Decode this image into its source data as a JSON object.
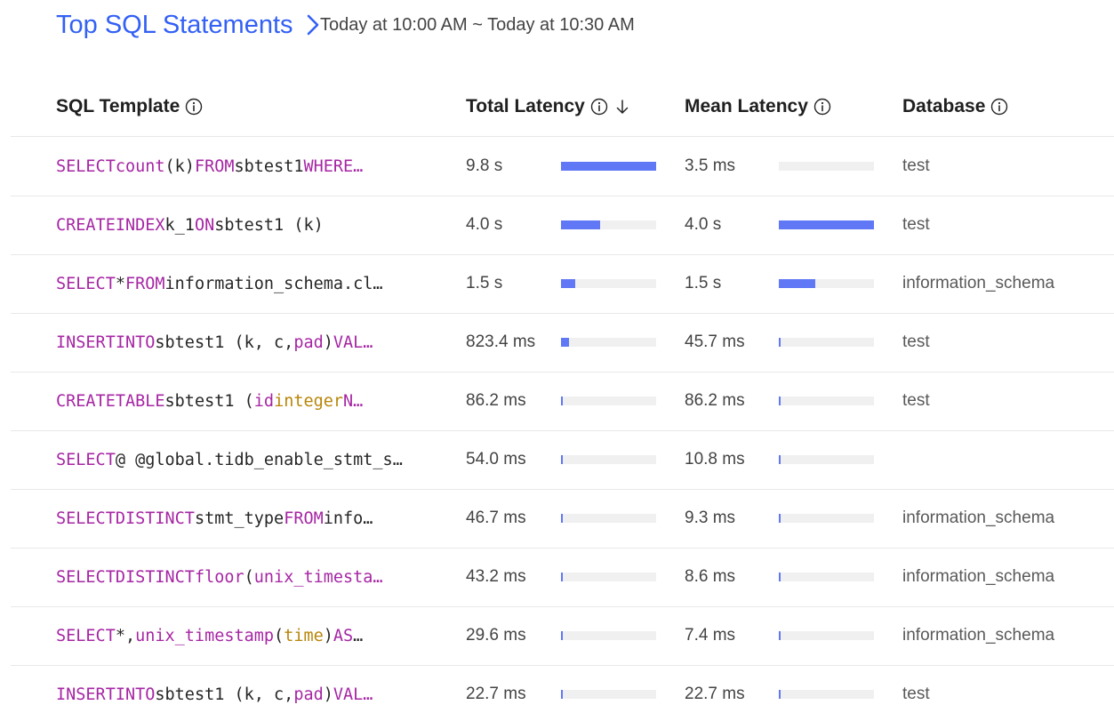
{
  "header": {
    "title": "Top SQL Statements",
    "time_range": "Today at 10:00 AM ~ Today at 10:30 AM"
  },
  "columns": {
    "sql_template": "SQL Template",
    "total_latency": "Total Latency",
    "mean_latency": "Mean Latency",
    "database": "Database"
  },
  "colors": {
    "accent": "#3360f5",
    "bar_fill": "#6078f5",
    "bar_track": "#f0f0f0",
    "keyword": "#a626a4",
    "type": "#b8860b"
  },
  "rows": [
    {
      "sql": [
        {
          "t": "SELECT",
          "k": "kw"
        },
        {
          "t": " "
        },
        {
          "t": "count",
          "k": "kw"
        },
        {
          "t": " (k) "
        },
        {
          "t": "FROM",
          "k": "kw"
        },
        {
          "t": " sbtest1 "
        },
        {
          "t": "WHERE…",
          "k": "kw"
        }
      ],
      "total_latency": "9.8 s",
      "total_ratio": 1.0,
      "mean_latency": "3.5 ms",
      "mean_ratio": 0.0,
      "database": "test"
    },
    {
      "sql": [
        {
          "t": "CREATE",
          "k": "kw"
        },
        {
          "t": " "
        },
        {
          "t": "INDEX",
          "k": "kw"
        },
        {
          "t": " k_1 "
        },
        {
          "t": "ON",
          "k": "kw"
        },
        {
          "t": " sbtest1 (k)"
        }
      ],
      "total_latency": "4.0 s",
      "total_ratio": 0.41,
      "mean_latency": "4.0 s",
      "mean_ratio": 1.0,
      "database": "test"
    },
    {
      "sql": [
        {
          "t": "SELECT",
          "k": "kw"
        },
        {
          "t": " * "
        },
        {
          "t": "FROM",
          "k": "kw"
        },
        {
          "t": " information_schema.cl…"
        }
      ],
      "total_latency": "1.5 s",
      "total_ratio": 0.15,
      "mean_latency": "1.5 s",
      "mean_ratio": 0.38,
      "database": "information_schema"
    },
    {
      "sql": [
        {
          "t": "INSERT",
          "k": "kw"
        },
        {
          "t": " "
        },
        {
          "t": "INTO",
          "k": "kw"
        },
        {
          "t": " sbtest1 (k, c, "
        },
        {
          "t": "pad",
          "k": "kw"
        },
        {
          "t": ") "
        },
        {
          "t": "VAL…",
          "k": "kw"
        }
      ],
      "total_latency": "823.4 ms",
      "total_ratio": 0.08,
      "mean_latency": "45.7 ms",
      "mean_ratio": 0.012,
      "database": "test"
    },
    {
      "sql": [
        {
          "t": "CREATE",
          "k": "kw"
        },
        {
          "t": " "
        },
        {
          "t": "TABLE",
          "k": "kw"
        },
        {
          "t": " sbtest1 ( "
        },
        {
          "t": "id",
          "k": "kw"
        },
        {
          "t": " "
        },
        {
          "t": "integer",
          "k": "ty"
        },
        {
          "t": " "
        },
        {
          "t": "N…",
          "k": "kw"
        }
      ],
      "total_latency": "86.2 ms",
      "total_ratio": 0.009,
      "mean_latency": "86.2 ms",
      "mean_ratio": 0.022,
      "database": "test"
    },
    {
      "sql": [
        {
          "t": "SELECT",
          "k": "kw"
        },
        {
          "t": " @ @global.tidb_enable_stmt_s…"
        }
      ],
      "total_latency": "54.0 ms",
      "total_ratio": 0.006,
      "mean_latency": "10.8 ms",
      "mean_ratio": 0.003,
      "database": ""
    },
    {
      "sql": [
        {
          "t": "SELECT",
          "k": "kw"
        },
        {
          "t": " "
        },
        {
          "t": "DISTINCT",
          "k": "kw"
        },
        {
          "t": " stmt_type "
        },
        {
          "t": "FROM",
          "k": "kw"
        },
        {
          "t": " info…"
        }
      ],
      "total_latency": "46.7 ms",
      "total_ratio": 0.005,
      "mean_latency": "9.3 ms",
      "mean_ratio": 0.002,
      "database": "information_schema"
    },
    {
      "sql": [
        {
          "t": "SELECT",
          "k": "kw"
        },
        {
          "t": " "
        },
        {
          "t": "DISTINCT",
          "k": "kw"
        },
        {
          "t": " "
        },
        {
          "t": "floor",
          "k": "kw"
        },
        {
          "t": " ("
        },
        {
          "t": "unix_timesta…",
          "k": "kw"
        }
      ],
      "total_latency": "43.2 ms",
      "total_ratio": 0.004,
      "mean_latency": "8.6 ms",
      "mean_ratio": 0.002,
      "database": "information_schema"
    },
    {
      "sql": [
        {
          "t": "SELECT",
          "k": "kw"
        },
        {
          "t": " *, "
        },
        {
          "t": "unix_timestamp",
          "k": "kw"
        },
        {
          "t": " ("
        },
        {
          "t": "time",
          "k": "ty"
        },
        {
          "t": ") "
        },
        {
          "t": "AS",
          "k": "kw"
        },
        {
          "t": " …"
        }
      ],
      "total_latency": "29.6 ms",
      "total_ratio": 0.003,
      "mean_latency": "7.4 ms",
      "mean_ratio": 0.002,
      "database": "information_schema"
    },
    {
      "sql": [
        {
          "t": "INSERT",
          "k": "kw"
        },
        {
          "t": " "
        },
        {
          "t": "INTO",
          "k": "kw"
        },
        {
          "t": " sbtest1 (k, c, "
        },
        {
          "t": "pad",
          "k": "kw"
        },
        {
          "t": ") "
        },
        {
          "t": "VAL…",
          "k": "kw"
        }
      ],
      "total_latency": "22.7 ms",
      "total_ratio": 0.002,
      "mean_latency": "22.7 ms",
      "mean_ratio": 0.006,
      "database": "test"
    }
  ]
}
